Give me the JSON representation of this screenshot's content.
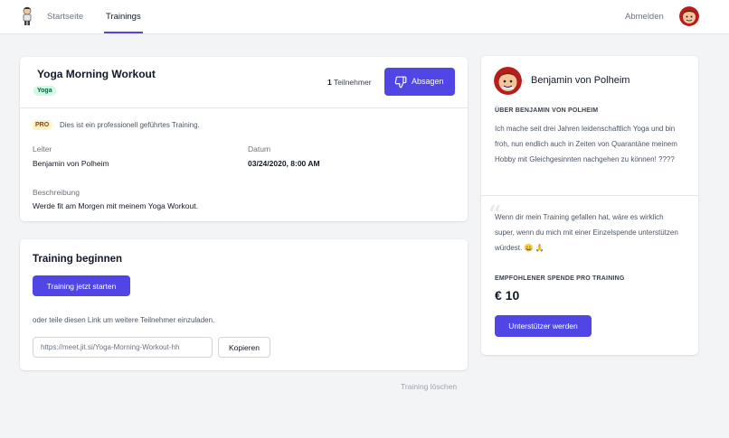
{
  "nav": {
    "logo_icon": "gymnast-logo-icon",
    "items": [
      {
        "label": "Startseite",
        "active": false
      },
      {
        "label": "Trainings",
        "active": true
      }
    ],
    "logout": "Abmelden",
    "avatar_icon": "user-avatar-icon"
  },
  "training": {
    "title": "Yoga Morning Workout",
    "tag": "Yoga",
    "participants_count": "1",
    "participants_label": "Teilnehmer",
    "cancel_label": "Absagen",
    "cancel_icon": "thumbs-down-icon",
    "pro_badge": "PRO",
    "pro_text": "Dies ist ein professionell geführtes Training.",
    "leader_label": "Leiter",
    "leader_value": "Benjamin von Polheim",
    "date_label": "Datum",
    "date_value": "03/24/2020, 8:00 AM",
    "description_label": "Beschreibung",
    "description_value": "Werde fit am Morgen mit meinem Yoga Workout."
  },
  "start": {
    "title": "Training beginnen",
    "start_button": "Training jetzt starten",
    "invite_text": "oder teile diesen Link um weitere Teilnehmer einzuladen.",
    "link_value": "https://meet.jit.si/Yoga-Morning-Workout-hh",
    "copy_button": "Kopieren"
  },
  "delete_label": "Training löschen",
  "trainer": {
    "name": "Benjamin von Polheim",
    "about_heading": "ÜBER BENJAMIN VON POLHEIM",
    "about_text": "Ich mache seit drei Jahren leidenschaftlich Yoga und bin froh, nun endlich auch in Zeiten von Quarantäne meinem Hobby mit Gleichgesinnten nachgehen zu können! ????",
    "quote_mark": "“",
    "support_text": "Wenn dir mein Training gefallen hat, wäre es wirklich super, wenn du mich mit einer Einzelspende unterstützen würdest. 😀 🙏",
    "donation_heading": "EMPFOHLENER SPENDE PRO TRAINING",
    "donation_amount": "€ 10",
    "support_button": "Unterstützer werden"
  },
  "colors": {
    "accent": "#4f46e5",
    "tag_bg": "#d1fae5",
    "pro_bg": "#fef3c7"
  }
}
